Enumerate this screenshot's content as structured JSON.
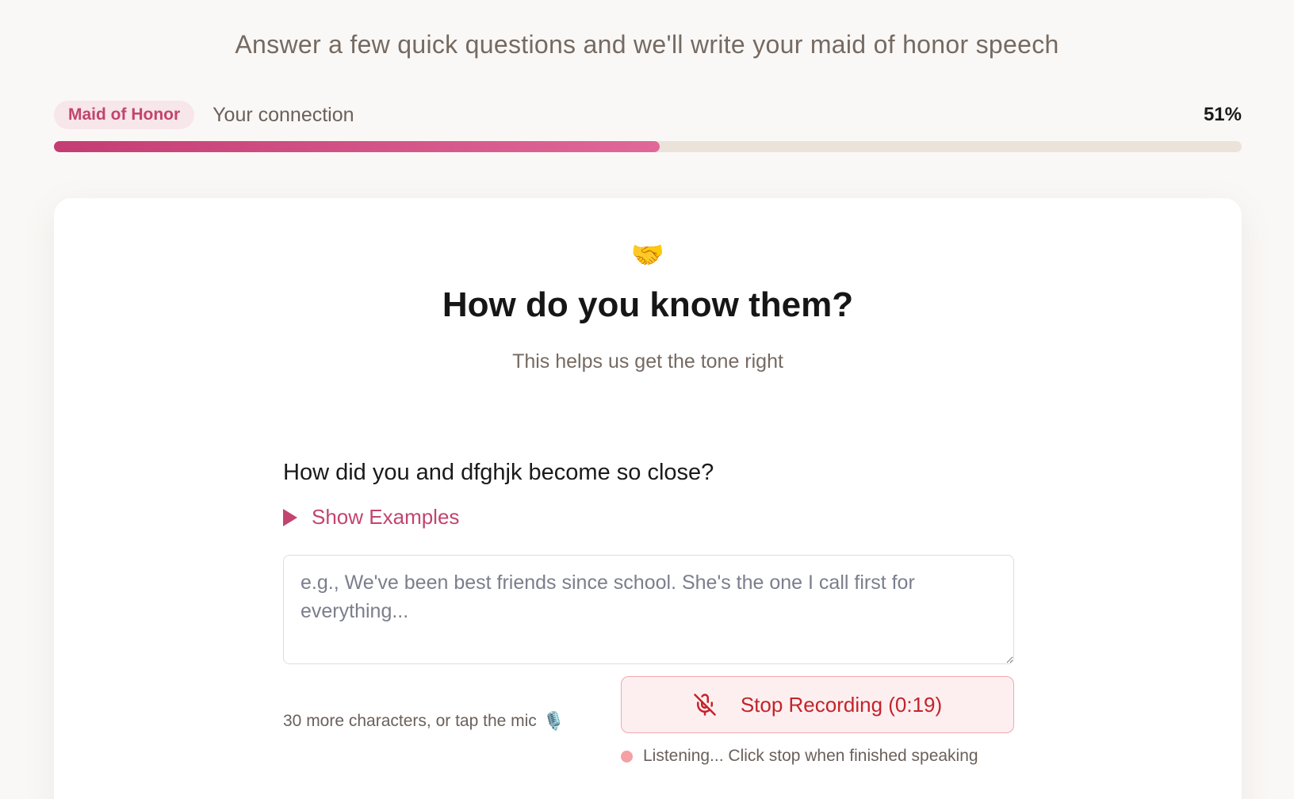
{
  "header": {
    "intro": "Answer a few quick questions and we'll write your maid of honor speech"
  },
  "progress": {
    "role_pill": "Maid of Honor",
    "step_label": "Your connection",
    "percent_label": "51%",
    "fraction": 0.51
  },
  "card": {
    "emoji": "🤝",
    "emoji_icon": "handshake-icon",
    "title": "How do you know them?",
    "subtitle": "This helps us get the tone right",
    "question": "How did you and dfghjk become so close?",
    "show_examples_label": "Show Examples",
    "answer": {
      "value": "",
      "placeholder": "e.g., We've been best friends since school. She's the one I call first for everything..."
    },
    "char_hint": "30 more characters, or tap the mic",
    "char_hint_emoji": "🎙️",
    "stop_button_label": "Stop Recording (0:19)",
    "listening_status": "Listening... Click stop when finished speaking"
  },
  "colors": {
    "accent": "#c2446f",
    "bar_start": "#c43d74",
    "bar_end": "#e06899",
    "stop_text": "#c3232a",
    "stop_bg": "#fdeff0",
    "listening_dot": "#f4a0a4"
  }
}
